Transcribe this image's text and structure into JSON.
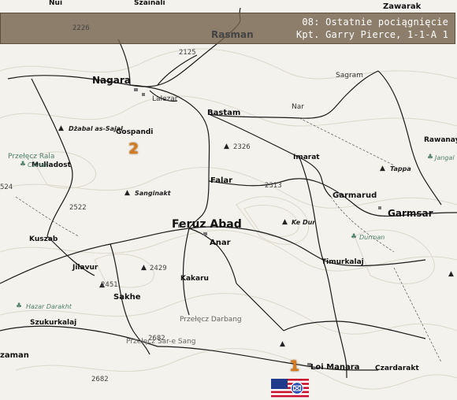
{
  "banner": {
    "line1": "08: Ostatnie pociągnięcie",
    "line2": "Kpt. Garry Pierce, 1-1-A 1"
  },
  "places": {
    "nui": "Nui",
    "szainali": "Szainali",
    "zawarak": "Zawarak",
    "rasman": "Rasman",
    "nagara": "Nagara",
    "lalezar": "Lalezar",
    "sagram": "Sagram",
    "nar": "Nar",
    "bastam": "Bastam",
    "gospandi": "Gospandi",
    "rawanay": "Rawanay",
    "mulladost": "Mulladost",
    "imarat": "Imarat",
    "falar": "Falar",
    "garmarud": "Garmarud",
    "garmsar": "Garmsar",
    "feruz_abad": "Feruz Abad",
    "kuszab": "Kuszab",
    "anar": "Anar",
    "timurkalaj": "Timurkalaj",
    "jilavur": "Jilavur",
    "kakaru": "Kakaru",
    "sakhe": "Sakhe",
    "szukurkalaj": "Szukurkalaj",
    "zaman": "zaman",
    "loi_manara": "Loi Manara",
    "czardarakt": "Czardarakt"
  },
  "hills": {
    "dzabal": "Dżabal as-Sajal",
    "sanginakt": "Sanginakt",
    "ketal": "Ke Dur",
    "tappa": "Tappa"
  },
  "elevations": {
    "e2226": "2226",
    "e2125": "2125",
    "e2326": "2326",
    "e2313": "2313",
    "e2522": "2522",
    "e2429": "2429",
    "e2451": "2451",
    "e2682a": "2682",
    "e2682b": "2682",
    "e524": "524"
  },
  "locations": {
    "przelecz_rala": "Przełęcz Rala",
    "przelecz_darbang": "Przełęcz Darbang",
    "przelecz_sar": "Przełęcz Sar-e Sang"
  },
  "vegetation": {
    "czinar": "Czinar",
    "jangal": "Jangal",
    "durman": "Durman",
    "hazar": "Hazar Darakht"
  },
  "objectives": {
    "first": "1",
    "second": "2"
  },
  "unit": {
    "flag": "USA",
    "icon": "infantry-marker-icon"
  },
  "colors": {
    "banner": "#76644e",
    "objective": "#d57b1f",
    "road": "#1a1a1a",
    "contour": "#ddd9cc",
    "water": "#4f7f6a"
  }
}
